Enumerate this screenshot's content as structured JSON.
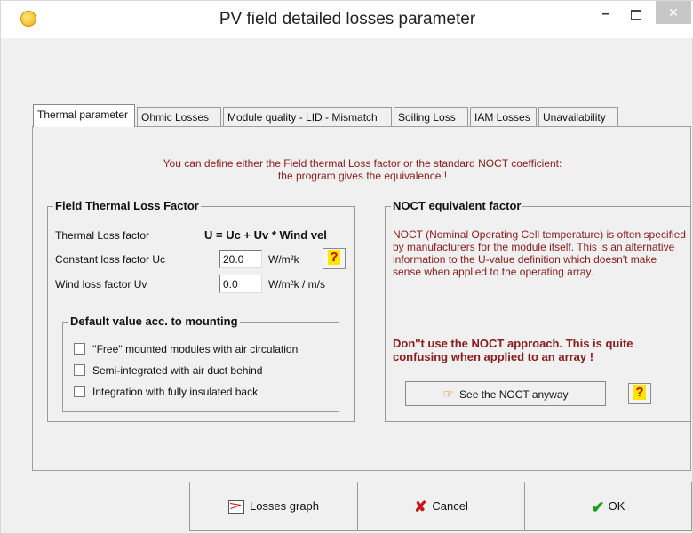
{
  "window": {
    "title": "PV field detailed losses parameter",
    "minimize": "–",
    "close": "✕"
  },
  "tabs": [
    {
      "label": "Thermal parameter"
    },
    {
      "label": "Ohmic Losses"
    },
    {
      "label": "Module quality - LID - Mismatch"
    },
    {
      "label": "Soiling Loss"
    },
    {
      "label": "IAM Losses"
    },
    {
      "label": "Unavailability"
    }
  ],
  "hint": {
    "line1": "You can define either the Field thermal Loss factor or the standard NOCT coefficient:",
    "line2": "the program gives the equivalence !"
  },
  "thermal": {
    "group_title": "Field Thermal Loss Factor",
    "loss_factor_label": "Thermal Loss factor",
    "formula": "U = Uc + Uv * Wind vel",
    "uc_label": "Constant loss factor  Uc",
    "uc_value": "20.0",
    "uc_unit": "W/m²k",
    "uv_label": "Wind loss factor  Uv",
    "uv_value": "0.0",
    "uv_unit": "W/m²k / m/s",
    "help": "?"
  },
  "mounting": {
    "group_title": "Default value acc. to mounting",
    "options": [
      {
        "label": "''Free'' mounted modules with air circulation",
        "checked": false
      },
      {
        "label": "Semi-integrated with air duct behind",
        "checked": false
      },
      {
        "label": "Integration with fully insulated back",
        "checked": false
      }
    ]
  },
  "noct": {
    "group_title": "NOCT equivalent factor",
    "text": "NOCT  (Nominal Operating Cell temperature) is often specified by manufacturers  for the module itself. This is an alternative information to the U-value definition which doesn't make sense when applied to the operating array.",
    "warning": "Don''t use the NOCT approach. This is quite confusing when applied to an array !",
    "see_button": "See the NOCT anyway",
    "help": "?"
  },
  "footer": {
    "graph_button": "Losses graph",
    "cancel_button": "Cancel",
    "ok_button": "OK"
  }
}
